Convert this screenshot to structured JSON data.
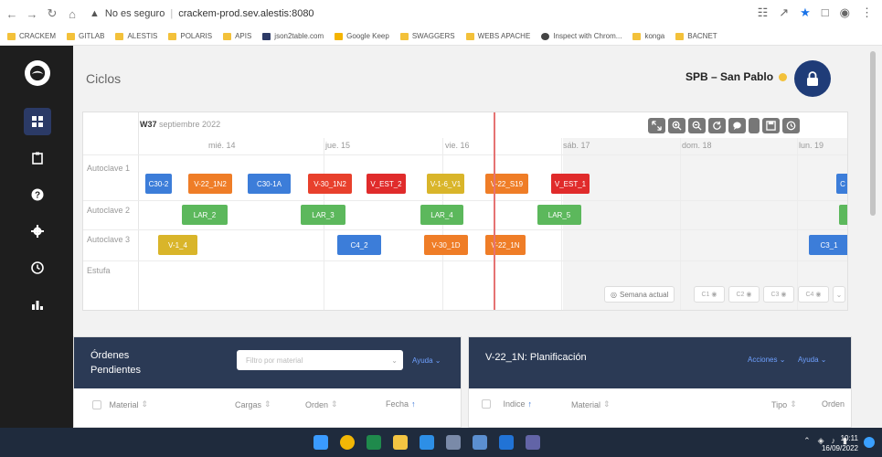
{
  "browser": {
    "insecure_label": "No es seguro",
    "url": "crackem-prod.sev.alestis:8080",
    "bookmarks": [
      "CRACKEM",
      "GITLAB",
      "ALESTIS",
      "POLARIS",
      "APIS",
      "json2table.com",
      "Google Keep",
      "SWAGGERS",
      "WEBS APACHE",
      "Inspect with Chrom...",
      "konga",
      "BACNET"
    ]
  },
  "page": {
    "title": "Ciclos",
    "plant": "SPB – San Pablo"
  },
  "timeline": {
    "week_label": "W37",
    "week_month": "septiembre 2022",
    "days": [
      "mié. 14",
      "jue. 15",
      "vie. 16",
      "sáb. 17",
      "dom. 18",
      "lun. 19"
    ],
    "rows": [
      "Autoclave 1",
      "Autoclave 2",
      "Autoclave 3",
      "Estufa"
    ],
    "blocks": [
      {
        "label": "C30-2",
        "color": "#3c7dd9"
      },
      {
        "label": "V-22_1N2",
        "color": "#ef7d27"
      },
      {
        "label": "C30-1A",
        "color": "#3c7dd9"
      },
      {
        "label": "V-30_1N2",
        "color": "#e8402c"
      },
      {
        "label": "V_EST_2",
        "color": "#e02b2b"
      },
      {
        "label": "V-1-6_V1",
        "color": "#d9b52a"
      },
      {
        "label": "V-22_S19",
        "color": "#ef7d27"
      },
      {
        "label": "V_EST_1",
        "color": "#e02b2b"
      },
      {
        "label": "C",
        "color": "#3c7dd9"
      },
      {
        "label": "LAR_2",
        "color": "#5cb85c"
      },
      {
        "label": "LAR_3",
        "color": "#5cb85c"
      },
      {
        "label": "LAR_4",
        "color": "#5cb85c"
      },
      {
        "label": "LAR_5",
        "color": "#5cb85c"
      },
      {
        "label": "",
        "color": "#5cb85c"
      },
      {
        "label": "V-1_4",
        "color": "#d9b52a"
      },
      {
        "label": "C4_2",
        "color": "#3c7dd9"
      },
      {
        "label": "V-30_1D",
        "color": "#ef7d27"
      },
      {
        "label": "V-22_1N",
        "color": "#ef7d27"
      },
      {
        "label": "C3_1",
        "color": "#3c7dd9"
      }
    ],
    "current_week_button": "Semana actual",
    "legend_chips": [
      "C1",
      "C2",
      "C3",
      "C4"
    ]
  },
  "orders": {
    "title_line1": "Órdenes",
    "title_line2": "Pendientes",
    "search_placeholder": "Filtro por material",
    "help_label": "Ayuda",
    "columns": [
      "Material",
      "Cargas",
      "Orden",
      "Fecha"
    ]
  },
  "planning": {
    "title": "V-22_1N: Planificación",
    "actions_label": "Acciones",
    "help_label": "Ayuda",
    "columns": [
      "Indice",
      "Material",
      "Tipo",
      "Orden"
    ]
  },
  "taskbar": {
    "time": "10:11",
    "date": "16/09/2022"
  },
  "colors": {
    "sidebar": "#1e1e1e",
    "active_nav": "#2b3a66",
    "lock_button": "#1f3c78",
    "panel_header": "#2b3a55",
    "now_line": "#e57373"
  }
}
